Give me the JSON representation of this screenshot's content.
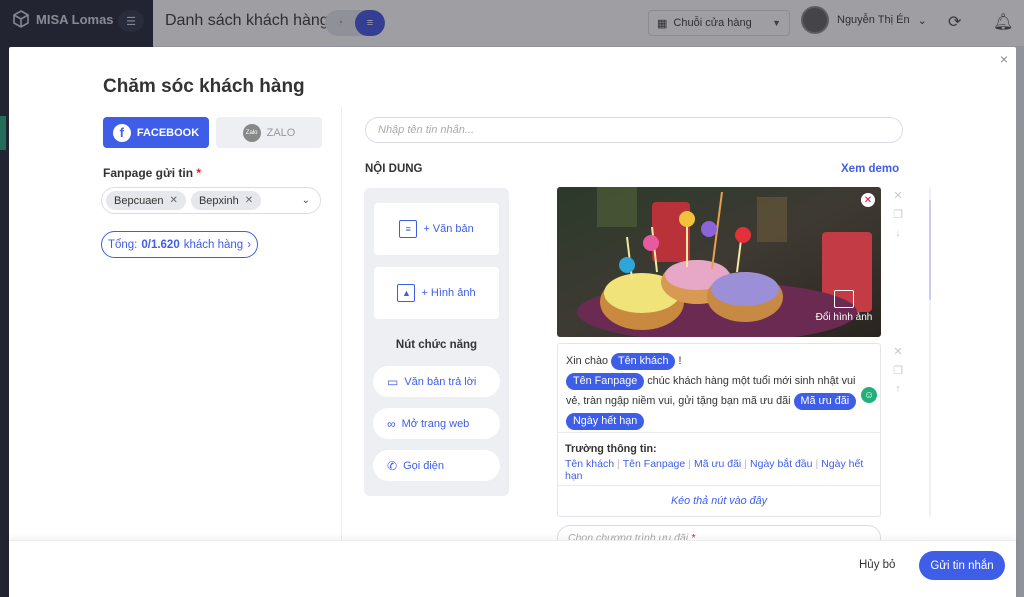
{
  "app": {
    "brand": "MISA Lomas",
    "page_title": "Danh sách khách hàng",
    "store_select": "Chuỗi cửa hàng",
    "user_name": "Nguyễn Thị Én"
  },
  "modal": {
    "title": "Chăm sóc khách hàng",
    "close": "×",
    "tabs": {
      "facebook": "FACEBOOK",
      "zalo": "ZALO",
      "zalo_logo": "Zalo"
    },
    "fanpage_label": "Fanpage gửi tin",
    "required_mark": "*",
    "fanpages": [
      {
        "name": "Bepcuaen"
      },
      {
        "name": "Bepxinh"
      }
    ],
    "total": {
      "prefix": "Tổng: ",
      "count": "0/1.620",
      "suffix": " khách hàng"
    },
    "message_name_placeholder": "Nhập tên tin nhắn...",
    "content_label": "NỘI DUNG",
    "demo_link": "Xem demo",
    "palette": {
      "text_block": "+ Văn bản",
      "image_block": "+ Hình ảnh",
      "function_heading": "Nút chức năng",
      "buttons": [
        {
          "label": "Văn bản trả lời",
          "icon": "reply-icon"
        },
        {
          "label": "Mở trang web",
          "icon": "link-icon"
        },
        {
          "label": "Gọi điện",
          "icon": "phone-icon"
        }
      ]
    },
    "image_block": {
      "change_label": "Đổi hình ảnh"
    },
    "text_block": {
      "greeting": "Xin chào",
      "token_customer": "Tên khách",
      "excl": "!",
      "token_fanpage": "Tên Fanpage",
      "line2": " chúc khách hàng một tuổi mới sinh nhật vui vẻ, tràn ngập niềm vui, gửi tặng bạn mã ưu đãi",
      "token_coupon": "Mã ưu đãi",
      "token_expiry": "Ngày hết hạn",
      "fields_title": "Trường thông tin:",
      "fields": [
        "Tên khách",
        "Tên Fanpage",
        "Mã ưu đãi",
        "Ngày bắt đầu",
        "Ngày hết hạn"
      ],
      "drop_zone": "Kéo thả nút vào đây"
    },
    "promo_placeholder": "Chọn chương trình ưu đãi",
    "footer": {
      "cancel": "Hủy bỏ",
      "send": "Gửi tin nhắn"
    }
  }
}
